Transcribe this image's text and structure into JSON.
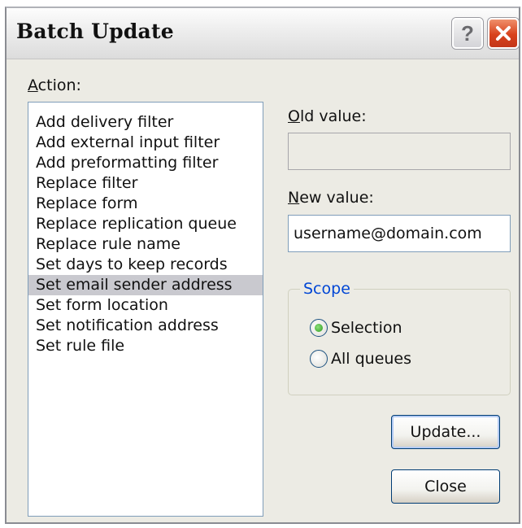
{
  "window": {
    "title": "Batch Update",
    "help_label": "?",
    "close_icon": "close-x-icon"
  },
  "action": {
    "label_hotkey": "A",
    "label_rest": "ction:",
    "items": [
      "Add delivery filter",
      "Add external input filter",
      "Add preformatting filter",
      "Replace filter",
      "Replace form",
      "Replace replication queue",
      "Replace rule name",
      "Set days to keep records",
      "Set email sender address",
      "Set form location",
      "Set notification address",
      "Set rule file"
    ],
    "selected": "Set email sender address"
  },
  "old_value": {
    "label_hotkey": "O",
    "label_rest": "ld value:",
    "value": ""
  },
  "new_value": {
    "label_hotkey": "N",
    "label_rest": "ew value:",
    "value": "username@domain.com"
  },
  "scope": {
    "legend": "Scope",
    "options": [
      "Selection",
      "All queues"
    ],
    "selected": "Selection"
  },
  "buttons": {
    "update": "Update...",
    "close": "Close"
  },
  "colors": {
    "dialog_bg": "#ecebe4",
    "scope_legend": "#0046d5",
    "close_button": "#d8421c",
    "selection_highlight": "#c9c9cf"
  }
}
